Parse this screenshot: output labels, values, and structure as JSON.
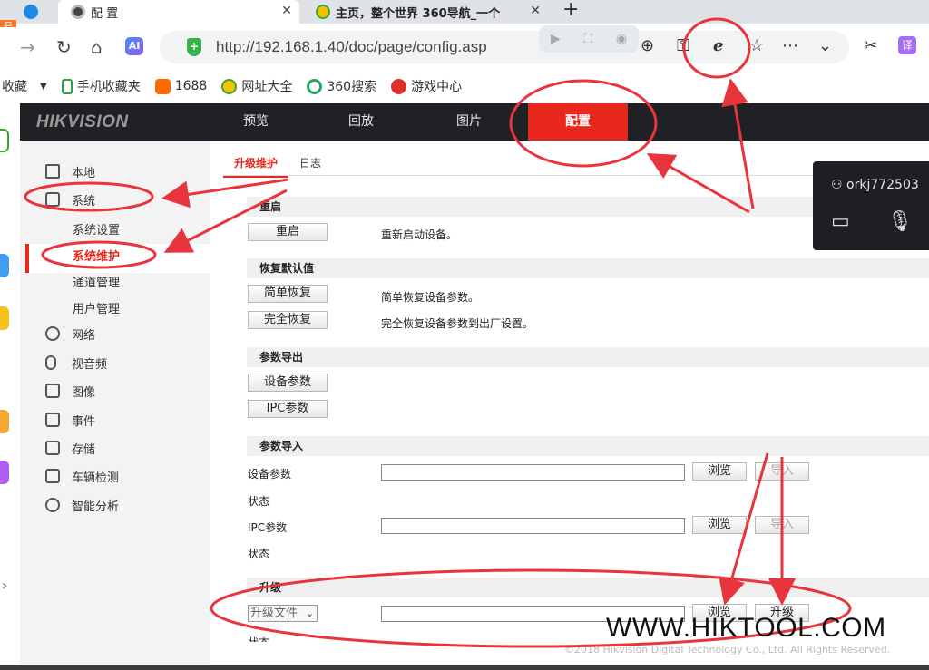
{
  "browser": {
    "side_badge": "号",
    "tabs": [
      {
        "label": "配 置",
        "close": "✕"
      },
      {
        "label": "主页，整个世界 360导航_一个",
        "close": "✕"
      }
    ],
    "new_tab": "+",
    "url": "http://192.168.1.40/doc/page/config.asp",
    "ai_label": "AI",
    "ext_label": "译",
    "toolbar_icons": [
      "back-icon",
      "reload-icon",
      "home-icon",
      "zoom-icon",
      "key-icon",
      "ie-compat-icon",
      "star-icon",
      "more-icon",
      "chevron-down-icon",
      "scissors-icon"
    ],
    "bookmarks": [
      "收藏",
      "手机收藏夹",
      "1688",
      "网址大全",
      "360搜索",
      "游戏中心"
    ]
  },
  "hik": {
    "logo": "HIKVISION",
    "nav": [
      "预览",
      "回放",
      "图片",
      "配置"
    ],
    "active_nav": "配置",
    "menu": {
      "local": "本地",
      "system": "系统",
      "system_sub": [
        "系统设置",
        "系统维护",
        "通道管理",
        "用户管理"
      ],
      "selected_sub": "系统维护",
      "others": [
        "网络",
        "视音频",
        "图像",
        "事件",
        "存储",
        "车辆检测",
        "智能分析"
      ]
    },
    "subtabs": [
      "升级维护",
      "日志"
    ],
    "sections": {
      "reboot": {
        "title": "重启",
        "button": "重启",
        "desc": "重新启动设备。"
      },
      "restore": {
        "title": "恢复默认值",
        "simple_button": "简单恢复",
        "simple_desc": "简单恢复设备参数。",
        "full_button": "完全恢复",
        "full_desc": "完全恢复设备参数到出厂设置。"
      },
      "export": {
        "title": "参数导出",
        "device_button": "设备参数",
        "ipc_button": "IPC参数"
      },
      "import": {
        "title": "参数导入",
        "device_label": "设备参数",
        "status_label": "状态",
        "ipc_label": "IPC参数",
        "browse": "浏览",
        "import_button": "导入"
      },
      "upgrade": {
        "title": "升级",
        "select_value": "升级文件",
        "browse": "浏览",
        "upgrade_button": "升级",
        "status_label": "状态"
      }
    },
    "copyright": "©2018 Hikvision Digital Technology Co., Ltd. All Rights Reserved."
  },
  "chat_panel": {
    "username": "orkj772503"
  },
  "watermark": "WWW.HIKTOOL.COM",
  "colors": {
    "accent_red": "#e8271d",
    "header_bg": "#202124",
    "annotation_red": "#e8353d"
  }
}
